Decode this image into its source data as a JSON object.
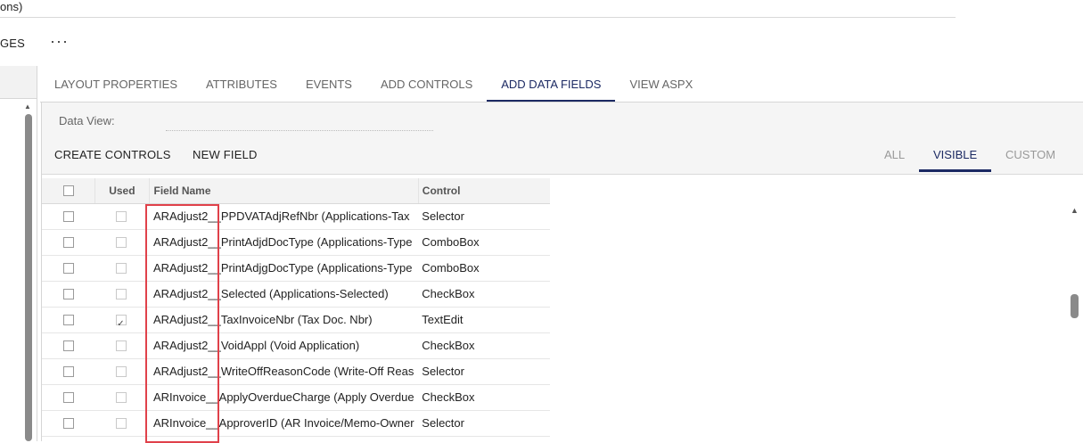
{
  "header": {
    "title": "ons)",
    "pages_label": "GES",
    "more": "···"
  },
  "tabs": [
    {
      "label": "LAYOUT PROPERTIES"
    },
    {
      "label": "ATTRIBUTES"
    },
    {
      "label": "EVENTS"
    },
    {
      "label": "ADD CONTROLS"
    },
    {
      "label": "ADD DATA FIELDS",
      "active": true
    },
    {
      "label": "VIEW ASPX"
    }
  ],
  "data_view": {
    "label": "Data View:",
    "value": ""
  },
  "toolbar": {
    "create_controls": "CREATE CONTROLS",
    "new_field": "NEW FIELD"
  },
  "filters": {
    "all": "ALL",
    "visible": "VISIBLE",
    "custom": "CUSTOM",
    "active": "VISIBLE"
  },
  "grid": {
    "columns": {
      "used": "Used",
      "field_name": "Field Name",
      "control": "Control"
    },
    "rows": [
      {
        "field": "ARAdjust2__PPDVATAdjRefNbr (Applications-Tax",
        "control": "Selector",
        "used": false
      },
      {
        "field": "ARAdjust2__PrintAdjdDocType (Applications-Type",
        "control": "ComboBox",
        "used": false
      },
      {
        "field": "ARAdjust2__PrintAdjgDocType (Applications-Type",
        "control": "ComboBox",
        "used": false
      },
      {
        "field": "ARAdjust2__Selected (Applications-Selected)",
        "control": "CheckBox",
        "used": false
      },
      {
        "field": "ARAdjust2__TaxInvoiceNbr (Tax Doc. Nbr)",
        "control": "TextEdit",
        "used": true
      },
      {
        "field": "ARAdjust2__VoidAppl (Void Application)",
        "control": "CheckBox",
        "used": false
      },
      {
        "field": "ARAdjust2__WriteOffReasonCode (Write-Off Reas",
        "control": "Selector",
        "used": false
      },
      {
        "field": "ARInvoice__ApplyOverdueCharge (Apply Overdue",
        "control": "CheckBox",
        "used": false
      },
      {
        "field": "ARInvoice__ApproverID (AR Invoice/Memo-Owner",
        "control": "Selector",
        "used": false
      }
    ]
  },
  "colors": {
    "accent": "#1c2a63",
    "highlight": "#e0414a"
  }
}
